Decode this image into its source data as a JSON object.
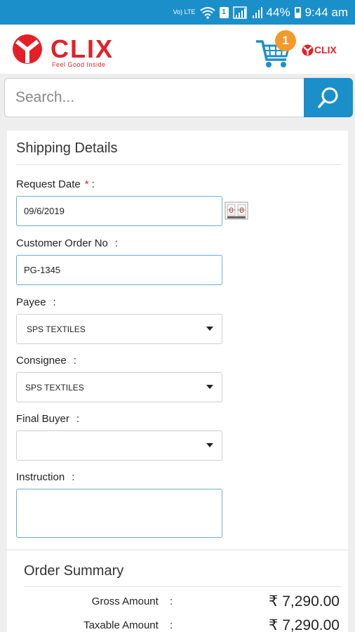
{
  "status_bar": {
    "volte": "Vo) LTE",
    "sim": "1",
    "battery": "44%",
    "time": "9:44 am"
  },
  "header": {
    "brand": "CLIX",
    "tagline": "Feel Good Inside",
    "mini_brand": "CLIX",
    "cart_count": "1",
    "brand_color": "#e32028",
    "accent_color": "#1b8fc9",
    "badge_color": "#f39a2b"
  },
  "search": {
    "placeholder": "Search..."
  },
  "shipping": {
    "title": "Shipping Details",
    "request_date": {
      "label": "Request Date",
      "required": "*",
      "colon": ":",
      "value": "09/6/2019"
    },
    "customer_order": {
      "label": "Customer Order No",
      "colon": ":",
      "value": "PG-1345"
    },
    "payee": {
      "label": "Payee",
      "colon": ":",
      "value": "SPS TEXTILES"
    },
    "consignee": {
      "label": "Consignee",
      "colon": ":",
      "value": "SPS TEXTILES"
    },
    "final_buyer": {
      "label": "Final Buyer",
      "colon": ":",
      "value": ""
    },
    "instruction": {
      "label": "Instruction",
      "colon": ":",
      "value": ""
    }
  },
  "summary": {
    "title": "Order Summary",
    "rows": [
      {
        "label": "Gross Amount",
        "colon": ":",
        "value": "₹ 7,290.00"
      },
      {
        "label": "Taxable Amount",
        "colon": ":",
        "value": "₹ 7,290.00"
      }
    ]
  }
}
